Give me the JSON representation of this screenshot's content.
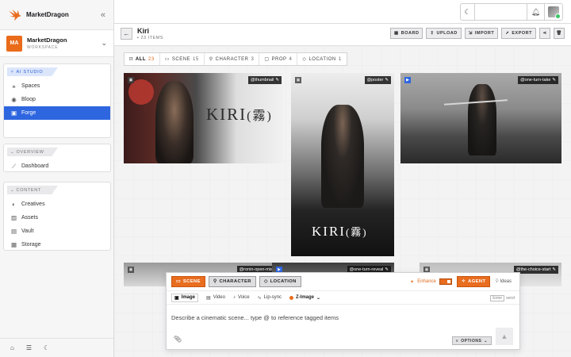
{
  "app": {
    "name": "MarketDragon"
  },
  "workspace": {
    "initials": "MA",
    "name": "MarketDragon",
    "subtitle": "WORKSPACE"
  },
  "sidebar": {
    "sections": [
      {
        "header": "AI STUDIO",
        "items": [
          {
            "label": "Spaces",
            "icon": "nodes-icon"
          },
          {
            "label": "Bloop",
            "icon": "bot-icon"
          },
          {
            "label": "Forge",
            "icon": "forge-icon",
            "active": true
          }
        ]
      },
      {
        "header": "OVERVIEW",
        "items": [
          {
            "label": "Dashboard",
            "icon": "chart-icon"
          }
        ]
      },
      {
        "header": "CONTENT",
        "items": [
          {
            "label": "Creatives",
            "icon": "palette-icon"
          },
          {
            "label": "Assets",
            "icon": "image-icon"
          },
          {
            "label": "Vault",
            "icon": "vault-icon"
          },
          {
            "label": "Storage",
            "icon": "storage-icon"
          }
        ]
      }
    ],
    "footer_icons": [
      "home-icon",
      "sliders-icon",
      "moon-icon"
    ]
  },
  "header": {
    "title": "Kiri",
    "count": "23 ITEMS",
    "actions": [
      "BOARD",
      "UPLOAD",
      "IMPORT",
      "EXPORT"
    ]
  },
  "filters": [
    {
      "label": "ALL",
      "count": "23",
      "active": true
    },
    {
      "label": "SCENE",
      "count": "15"
    },
    {
      "label": "CHARACTER",
      "count": "3"
    },
    {
      "label": "PROP",
      "count": "4"
    },
    {
      "label": "LOCATION",
      "count": "1"
    }
  ],
  "cards": [
    {
      "tag": "@thumbnail",
      "title_text": "KIRI",
      "title_kanji": "(霧)"
    },
    {
      "tag": "@poster",
      "title_text": "KIRI",
      "title_kanji": "(霧)"
    },
    {
      "tag": "@one-turn-take"
    },
    {
      "tag": "@ronin-open-mist"
    },
    {
      "tag": "@one-turn-reveal"
    },
    {
      "tag": "@the-choice-start"
    }
  ],
  "composer": {
    "chips": [
      "SCENE",
      "CHARACTER",
      "LOCATION"
    ],
    "enhance_label": "Enhance",
    "agent_label": "AGENT",
    "ideas_label": "Ideas",
    "modes": [
      "Image",
      "Video",
      "Voice",
      "Lip-sync"
    ],
    "model": "Z-Image",
    "send_key": "Enter",
    "send_hint": "send",
    "placeholder": "Describe a cinematic scene... type @ to reference tagged items",
    "options_label": "OPTIONS"
  },
  "colors": {
    "accent": "#e96d1f",
    "active_nav": "#2e66e0"
  }
}
